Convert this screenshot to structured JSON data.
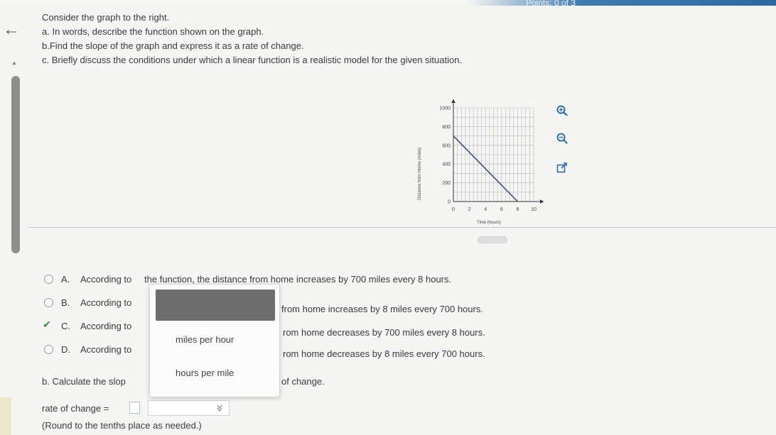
{
  "header": {
    "points_text": "Points: 0 of 3"
  },
  "question": {
    "intro": "Consider the graph to the right.",
    "part_a": "a. In words, describe the function shown on the graph.",
    "part_b": "b.Find the slope of the graph and express it as a rate of change.",
    "part_c": "c. Briefly discuss the conditions under which a linear function is a realistic model for the given situation."
  },
  "chart_data": {
    "type": "line",
    "ylabel": "Distance from Home (miles)",
    "xlabel": "Time (hours)",
    "x_ticks": [
      "0",
      "2",
      "4",
      "6",
      "8",
      "10"
    ],
    "y_ticks": [
      "0",
      "200",
      "400",
      "600",
      "800",
      "1000"
    ],
    "xlim": [
      0,
      10
    ],
    "ylim": [
      0,
      1000
    ],
    "grid": true,
    "series": [
      {
        "x": [
          0,
          8
        ],
        "y": [
          700,
          0
        ]
      }
    ]
  },
  "tools": {
    "zoom_in": "zoom-in-icon",
    "zoom_out": "zoom-out-icon",
    "popout": "external-link-icon"
  },
  "options": [
    {
      "letter": "A.",
      "prefix": "According to",
      "text": "the function, the distance from home increases by 700 miles every 8 hours."
    },
    {
      "letter": "B.",
      "prefix": "According to",
      "text": "from home increases by 8 miles every 700 hours."
    },
    {
      "letter": "C.",
      "prefix": "According to",
      "text": "rom home decreases by 700 miles every 8 hours."
    },
    {
      "letter": "D.",
      "prefix": "According to",
      "text": "rom home decreases by 8 miles every 700 hours."
    }
  ],
  "selected_option": "C.",
  "dropdown": {
    "items": [
      "miles per hour",
      "hours per mile"
    ]
  },
  "part_b_prompt": {
    "start": "b. Calculate the slop",
    "end": "of change."
  },
  "rate_row": {
    "label": "rate of change =",
    "hint": "(Round to the tenths place as needed.)"
  }
}
